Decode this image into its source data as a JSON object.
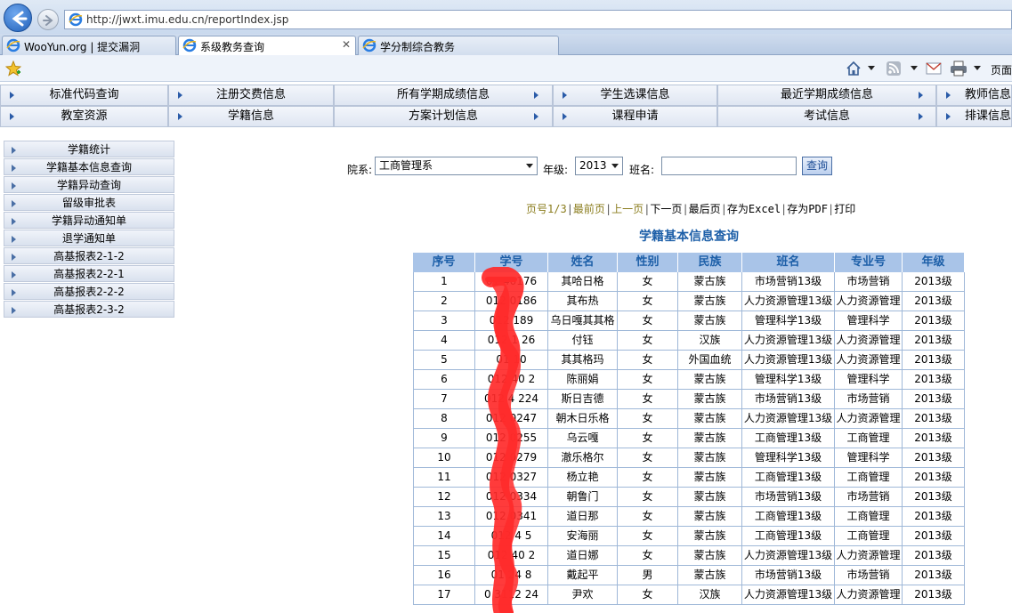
{
  "browser": {
    "url": "http://jwxt.imu.edu.cn/reportIndex.jsp",
    "tabs": [
      {
        "label": "WooYun.org | 提交漏洞"
      },
      {
        "label": "系级教务查询"
      },
      {
        "label": "学分制综合教务"
      }
    ],
    "close_glyph": "✕",
    "page_menu_label": "页面"
  },
  "top_menu": {
    "row1": [
      "标准代码查询",
      "注册交费信息",
      "所有学期成绩信息",
      "学生选课信息",
      "最近学期成绩信息",
      "教师信息"
    ],
    "row2": [
      "教室资源",
      "学籍信息",
      "方案计划信息",
      "课程申请",
      "考试信息",
      "排课信息"
    ]
  },
  "sidebar": {
    "items": [
      "学籍统计",
      "学籍基本信息查询",
      "学籍异动查询",
      "留级审批表",
      "学籍异动通知单",
      "退学通知单",
      "高基报表2-1-2",
      "高基报表2-2-1",
      "高基报表2-2-2",
      "高基报表2-3-2"
    ]
  },
  "form": {
    "dept_label": "院系:",
    "dept_value": "工商管理系",
    "grade_label": "年级:",
    "grade_value": "2013",
    "class_label": "班名:",
    "class_value": "",
    "query_label": "查询"
  },
  "pager": {
    "page_info": "页号1/3",
    "first": "最前页",
    "prev": "上一页",
    "next": "下一页",
    "last": "最后页",
    "excel": "存为Excel",
    "pdf": "存为PDF",
    "print": "打印",
    "sep": "|"
  },
  "report_title": "学籍基本信息查询",
  "table": {
    "headers": [
      "序号",
      "学号",
      "姓名",
      "性别",
      "民族",
      "班名",
      "专业号",
      "年级"
    ],
    "rows": [
      [
        "1",
        "01  40176",
        "其哈日格",
        "女",
        "蒙古族",
        "市场营销13级",
        "市场营销",
        "2013级"
      ],
      [
        "2",
        "012  0186",
        "其布热",
        "女",
        "蒙古族",
        "人力资源管理13级",
        "人力资源管理",
        "2013级"
      ],
      [
        "3",
        "012  189",
        "乌日嘎其其格",
        "女",
        "蒙古族",
        "管理科学13级",
        "管理科学",
        "2013级"
      ],
      [
        "4",
        "012  1  26",
        "付钰",
        "女",
        "汉族",
        "人力资源管理13级",
        "人力资源管理",
        "2013级"
      ],
      [
        "5",
        "01  10  ",
        "其其格玛",
        "女",
        "外国血统",
        "人力资源管理13级",
        "人力资源管理",
        "2013级"
      ],
      [
        "6",
        "012  40  2",
        "陈丽娟",
        "女",
        "蒙古族",
        "管理科学13级",
        "管理科学",
        "2013级"
      ],
      [
        "7",
        "012  4  224",
        "斯日吉德",
        "女",
        "蒙古族",
        "市场营销13级",
        "市场营销",
        "2013级"
      ],
      [
        "8",
        "012  0247",
        "朝木日乐格",
        "女",
        "蒙古族",
        "人力资源管理13级",
        "人力资源管理",
        "2013级"
      ],
      [
        "9",
        "012  0255",
        "乌云嘎",
        "女",
        "蒙古族",
        "工商管理13级",
        "工商管理",
        "2013级"
      ],
      [
        "10",
        "012  0279",
        "澈乐格尔",
        "女",
        "蒙古族",
        "管理科学13级",
        "管理科学",
        "2013级"
      ],
      [
        "11",
        "012  0327",
        "杨立艳",
        "女",
        "蒙古族",
        "工商管理13级",
        "工商管理",
        "2013级"
      ],
      [
        "12",
        "012  0334",
        "朝鲁门",
        "女",
        "蒙古族",
        "市场营销13级",
        "市场营销",
        "2013级"
      ],
      [
        "13",
        "012  0341",
        "道日那",
        "女",
        "蒙古族",
        "工商管理13级",
        "工商管理",
        "2013级"
      ],
      [
        "14",
        "012  4  5",
        "安海丽",
        "女",
        "蒙古族",
        "工商管理13级",
        "工商管理",
        "2013级"
      ],
      [
        "15",
        "012  40  2",
        "道日娜",
        "女",
        "蒙古族",
        "人力资源管理13级",
        "人力资源管理",
        "2013级"
      ],
      [
        "16",
        "01  24  8",
        "戴起平",
        "男",
        "蒙古族",
        "市场营销13级",
        "市场营销",
        "2013级"
      ],
      [
        "17",
        "0  3112  24",
        "尹欢",
        "女",
        "汉族",
        "人力资源管理13级",
        "人力资源管理",
        "2013级"
      ]
    ]
  },
  "colors": {
    "header_bg": "#a9c4e8",
    "header_text": "#1d5fa8",
    "title_text": "#1d5fa8",
    "pager_link": "#8b7d1e",
    "redaction": "#ff2a2a"
  }
}
